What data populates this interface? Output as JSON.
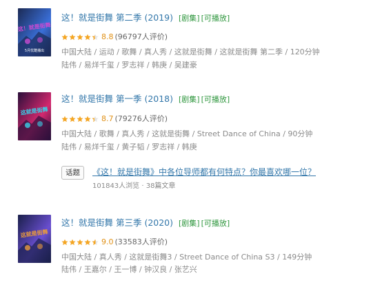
{
  "results": [
    {
      "title": "这！就是街舞 第二季 (2019)",
      "tags": [
        "[剧集]",
        "[可播放]"
      ],
      "rating": 8.8,
      "rating_text": "8.8",
      "votes": "(96797人评价)",
      "meta_line1": "中国大陆 / 运动 / 歌舞 / 真人秀 / 这就是街舞 / 这就是街舞 第二季 / 120分钟",
      "meta_line2": "陆伟 / 易烊千玺 / 罗志祥 / 韩庚 / 吴建豪",
      "poster_text": "这！就是街舞",
      "poster_sub": "5月优酷播出",
      "poster_colors": [
        "#1b2a55",
        "#3a6fd8",
        "#c94bd1"
      ]
    },
    {
      "title": "这！就是街舞 第一季 (2018)",
      "tags": [
        "[剧集]",
        "[可播放]"
      ],
      "rating": 8.7,
      "rating_text": "8.7",
      "votes": "(79276人评价)",
      "meta_line1": "中国大陆 / 歌舞 / 真人秀 / 这就是街舞 / Street Dance of China / 90分钟",
      "meta_line2": "陆伟 / 易烊千玺 / 黄子韬 / 罗志祥 / 韩庚",
      "poster_text": "这就是街舞",
      "poster_sub": "",
      "poster_colors": [
        "#2a0f3a",
        "#d4286e",
        "#3bd0e8"
      ]
    },
    {
      "title": "这！就是街舞 第三季 (2020)",
      "tags": [
        "[剧集]",
        "[可播放]"
      ],
      "rating": 9.0,
      "rating_text": "9.0",
      "votes": "(33583人评价)",
      "meta_line1": "中国大陆 / 真人秀 / 这就是街舞3 / Street Dance of China S3 / 149分钟",
      "meta_line2": "陆伟 / 王嘉尔 / 王一博 / 钟汉良 / 张艺兴",
      "poster_text": "这就是街舞",
      "poster_sub": "",
      "poster_colors": [
        "#1a1f4a",
        "#6a4fd1",
        "#e89a3c"
      ]
    }
  ],
  "topic": {
    "chip": "话题",
    "title": "《这！就是街舞》中各位导师都有何特点？你最喜欢哪一位？",
    "stats": "101843人浏览 · 38篇文章"
  },
  "colors": {
    "link": "#3377aa",
    "tag_green": "#2e963d",
    "score": "#e09015",
    "star": "#f5a623"
  }
}
